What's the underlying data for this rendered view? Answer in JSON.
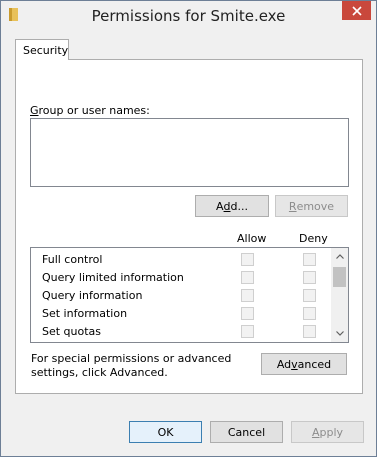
{
  "window": {
    "title": "Permissions for Smite.exe",
    "close_icon": "close-icon",
    "app_icon": "folder-icon"
  },
  "tabs": [
    {
      "label": "Security",
      "selected": true
    }
  ],
  "users_group": {
    "label": "Group or user names:",
    "items": []
  },
  "buttons": {
    "add": "Add...",
    "remove": "Remove",
    "advanced": "Advanced",
    "ok": "OK",
    "cancel": "Cancel",
    "apply": "Apply"
  },
  "permissions": {
    "columns": {
      "allow": "Allow",
      "deny": "Deny"
    },
    "rows": [
      {
        "name": "Full control",
        "allow": false,
        "deny": false
      },
      {
        "name": "Query limited information",
        "allow": false,
        "deny": false
      },
      {
        "name": "Query information",
        "allow": false,
        "deny": false
      },
      {
        "name": "Set information",
        "allow": false,
        "deny": false
      },
      {
        "name": "Set quotas",
        "allow": false,
        "deny": false
      }
    ]
  },
  "special_permissions_text": "For special permissions or advanced settings, click Advanced.",
  "colors": {
    "close_red": "#c9483c",
    "window_bg": "#f0f0f0",
    "default_button_border": "#3c7fb1"
  }
}
